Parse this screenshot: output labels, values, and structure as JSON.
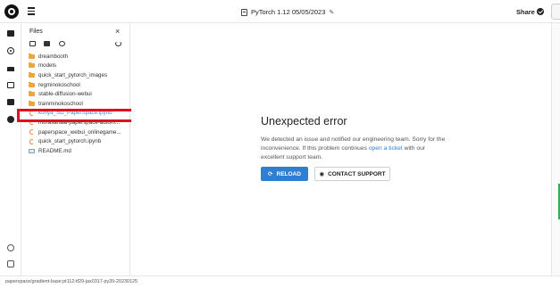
{
  "header": {
    "notebook_title": "PyTorch 1.12 05/05/2023",
    "share_label": "Share",
    "menu_icon": "hamburger-menu-icon",
    "edit_icon": "pencil-icon"
  },
  "files_panel": {
    "title": "Files",
    "close_icon": "close-icon",
    "items": [
      {
        "label": "dreambooth",
        "type": "folder"
      },
      {
        "label": "models",
        "type": "folder"
      },
      {
        "label": "quick_start_pytorch_images",
        "type": "folder"
      },
      {
        "label": "regminokoschool",
        "type": "folder"
      },
      {
        "label": "stable-diffusion-webui",
        "type": "folder"
      },
      {
        "label": "trainminokoschool",
        "type": "folder"
      },
      {
        "label": "kohya_SD_PaperSpace.ipynb",
        "type": "notebook",
        "selected": true
      },
      {
        "label": "murasanaai-paperspace-autom...",
        "type": "notebook"
      },
      {
        "label": "paperspace_webui_onlinegame...",
        "type": "notebook"
      },
      {
        "label": "quick_start_pytorch.ipynb",
        "type": "notebook"
      },
      {
        "label": "README.md",
        "type": "doc"
      }
    ]
  },
  "error": {
    "title": "Unexpected error",
    "body_before_link": "We detected an issue and notified our engineering team. Sorry for the inconvenience. If this problem continues ",
    "link_text": "open a ticket",
    "body_after_link": " with our excellent support team.",
    "reload_label": "RELOAD",
    "support_label": "CONTACT SUPPORT"
  },
  "status_bar": {
    "text": "paperspace/gradient-base:pt112-tf29-jax0317-py39-20230125"
  },
  "colors": {
    "accent": "#2f7fd0",
    "highlight_box": "#e0111f",
    "folder": "#f0a63a"
  }
}
